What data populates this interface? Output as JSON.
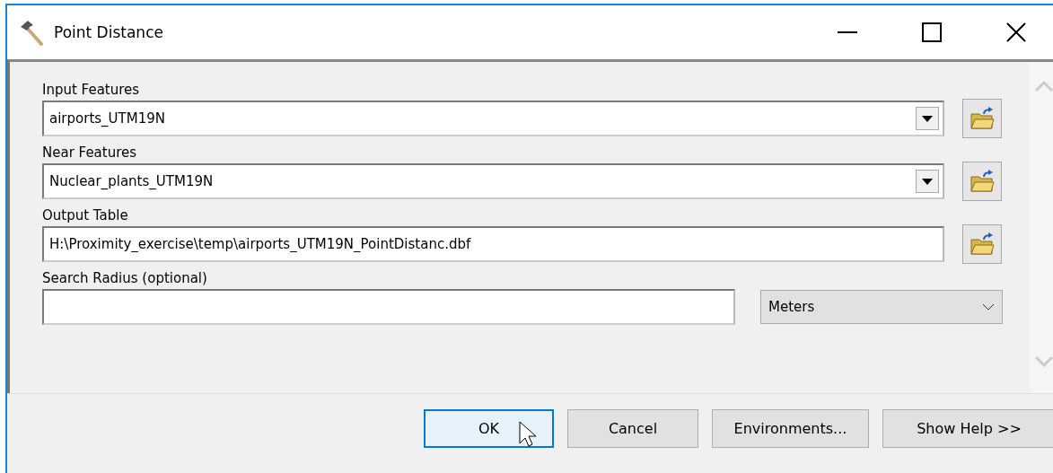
{
  "window": {
    "title": "Point Distance"
  },
  "parameters": [
    {
      "label": "Input Features",
      "kind": "combo",
      "value": "airports_UTM19N"
    },
    {
      "label": "Near Features",
      "kind": "combo",
      "value": "Nuclear_plants_UTM19N"
    },
    {
      "label": "Output Table",
      "kind": "text",
      "value": "H:\\Proximity_exercise\\temp\\airports_UTM19N_PointDistanc.dbf"
    },
    {
      "label": "Search Radius (optional)",
      "kind": "linear",
      "unit": "Meters"
    }
  ],
  "buttons": [
    {
      "label": "OK",
      "default": true
    },
    {
      "label": "Cancel",
      "default": false
    },
    {
      "label": "Environments...",
      "default": false
    },
    {
      "label": "Show Help >>",
      "default": false
    }
  ]
}
